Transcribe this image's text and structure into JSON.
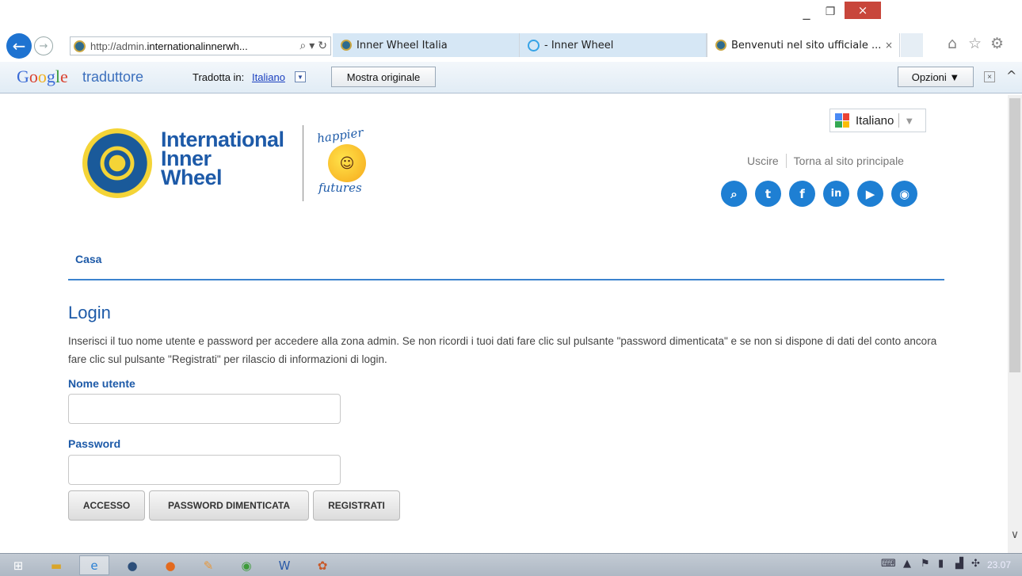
{
  "browser": {
    "address": {
      "prefix": "http://admin.",
      "domain": "internationalinnerwh...",
      "search_icon": "search-icon",
      "refresh_icon": "refresh-icon"
    },
    "tabs": [
      {
        "label": "Inner Wheel Italia"
      },
      {
        "label": "- Inner Wheel"
      },
      {
        "label": "Benvenuti nel sito ufficiale ...",
        "close": "×"
      }
    ],
    "window": {
      "minimize": "_",
      "maximize": "❐",
      "close": "×"
    }
  },
  "translate_bar": {
    "logo": [
      "G",
      "o",
      "o",
      "g",
      "l",
      "e"
    ],
    "product": "traduttore",
    "label": "Tradotta in:",
    "language": "Italiano",
    "show_original": "Mostra originale",
    "options": "Opzioni ▼",
    "close": "×"
  },
  "header": {
    "logo_lines": [
      "International",
      "Inner",
      "Wheel"
    ],
    "happier_top": "happier",
    "happier_bottom": "futures",
    "language_select": "Italiano",
    "links": [
      "Uscire",
      "Torna al sito principale"
    ],
    "social_icons": [
      "search-icon",
      "twitter-icon",
      "facebook-icon",
      "linkedin-icon",
      "play-icon",
      "rss-icon"
    ]
  },
  "nav": {
    "home": "Casa"
  },
  "login": {
    "title": "Login",
    "intro": "Inserisci il tuo nome utente e password per accedere alla zona admin. Se non ricordi i tuoi dati fare clic sul pulsante \"password dimenticata\" e se non si dispone di dati del conto ancora fare clic sul pulsante \"Registrati\" per rilascio di informazioni di login.",
    "username_label": "Nome utente",
    "username_value": "",
    "password_label": "Password",
    "password_value": "",
    "buttons": {
      "login": "ACCESSO",
      "forgot": "PASSWORD DIMENTICATA",
      "register": "REGISTRATI"
    }
  },
  "taskbar": {
    "clock": "23.07"
  },
  "colors": {
    "accent": "#1d5aa8",
    "social": "#1e7fd3",
    "nav_line": "#3b83cf"
  }
}
